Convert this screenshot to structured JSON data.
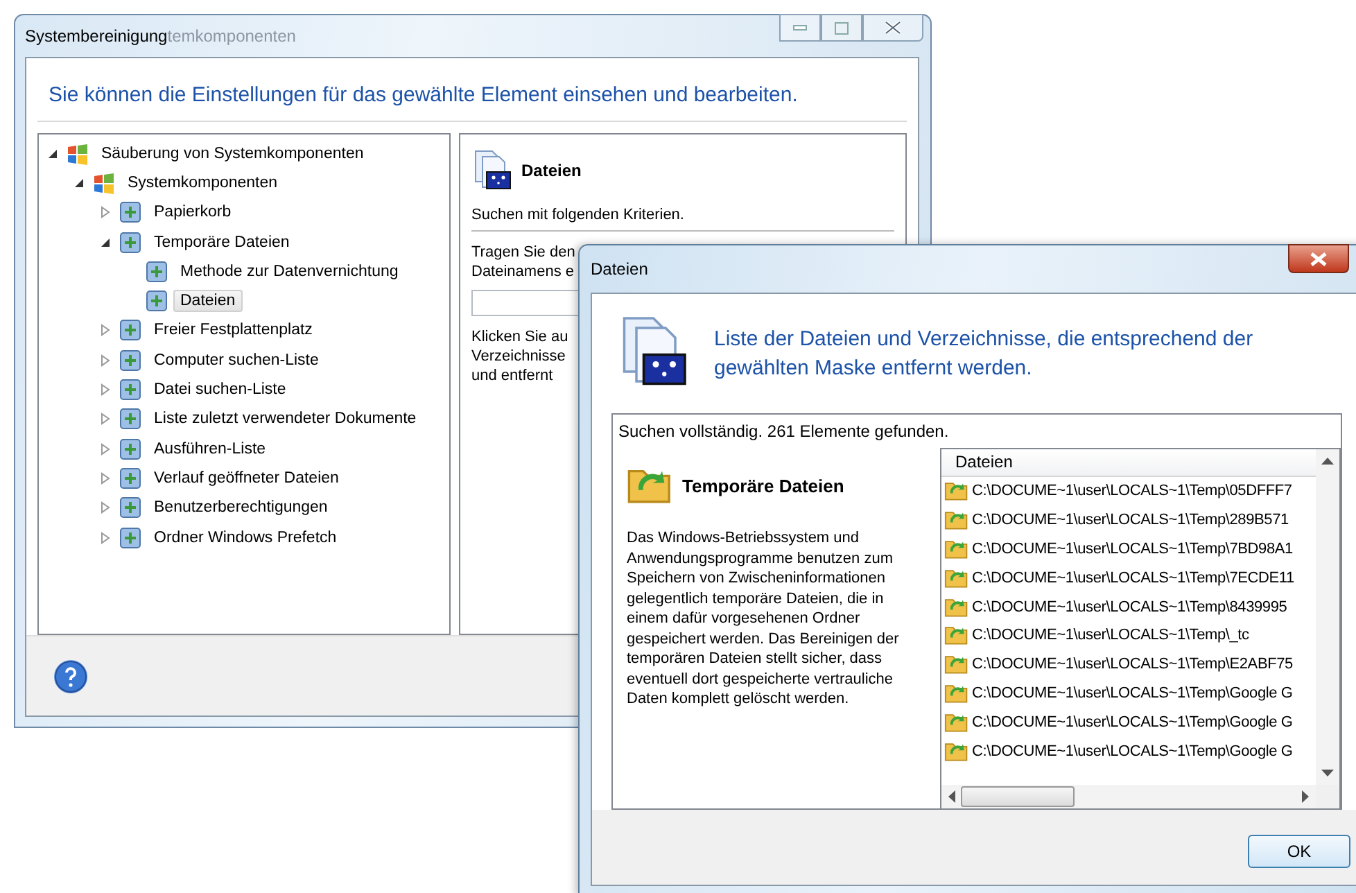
{
  "background_window": {
    "title": "Systembereinigung",
    "title_faded": "temkomponenten",
    "heading": "Sie können die Einstellungen für das gewählte Element einsehen und bearbeiten.",
    "tree": [
      {
        "label": "Säuberung von Systemkomponenten",
        "expanded": true,
        "selected": false,
        "children": [
          {
            "label": "Systemkomponenten",
            "expanded": true,
            "selected": false,
            "children": [
              {
                "label": "Papierkorb",
                "expanded": false,
                "selected": false
              },
              {
                "label": "Temporäre Dateien",
                "expanded": true,
                "selected": false,
                "children": [
                  {
                    "label": "Methode zur Datenvernichtung",
                    "selected": false
                  },
                  {
                    "label": "Dateien",
                    "selected": true
                  }
                ]
              },
              {
                "label": "Freier Festplattenplatz",
                "expanded": false,
                "selected": false
              },
              {
                "label": "Computer suchen-Liste",
                "expanded": false,
                "selected": false
              },
              {
                "label": "Datei suchen-Liste",
                "expanded": false,
                "selected": false
              },
              {
                "label": "Liste zuletzt verwendeter Dokumente",
                "expanded": false,
                "selected": false
              },
              {
                "label": "Ausführen-Liste",
                "expanded": false,
                "selected": false
              },
              {
                "label": "Verlauf geöffneter Dateien",
                "expanded": false,
                "selected": false
              },
              {
                "label": "Benutzerberechtigungen",
                "expanded": false,
                "selected": false
              },
              {
                "label": "Ordner Windows Prefetch",
                "expanded": false,
                "selected": false
              }
            ]
          }
        ]
      }
    ],
    "detail": {
      "title": "Dateien",
      "criteria": "Suchen mit folgenden Kriterien.",
      "hint_lines": [
        "Tragen Sie den",
        "Dateinamens e"
      ],
      "note_lines": [
        "Klicken Sie au",
        "Verzeichnisse",
        "und entfernt"
      ]
    }
  },
  "dialog": {
    "title": "Dateien",
    "heading": "Liste der Dateien und Verzeichnisse, die entsprechend der gewählten Maske entfernt werden.",
    "status": "Suchen vollständig. 261 Elemente gefunden.",
    "category": "Temporäre Dateien",
    "description": "Das Windows-Betriebssystem und Anwendungsprogramme benutzen zum Speichern von Zwischeninformationen gelegentlich temporäre Dateien, die in einem dafür vorgesehenen Ordner gespeichert werden. Das Bereinigen der temporären Dateien stellt sicher, dass eventuell dort gespeicherte vertrauliche Daten komplett gelöscht werden.",
    "list": {
      "column": "Dateien",
      "rows": [
        "C:\\DOCUME~1\\user\\LOCALS~1\\Temp\\05DFFF7",
        "C:\\DOCUME~1\\user\\LOCALS~1\\Temp\\289B571",
        "C:\\DOCUME~1\\user\\LOCALS~1\\Temp\\7BD98A1",
        "C:\\DOCUME~1\\user\\LOCALS~1\\Temp\\7ECDE11",
        "C:\\DOCUME~1\\user\\LOCALS~1\\Temp\\8439995",
        "C:\\DOCUME~1\\user\\LOCALS~1\\Temp\\_tc",
        "C:\\DOCUME~1\\user\\LOCALS~1\\Temp\\E2ABF75",
        "C:\\DOCUME~1\\user\\LOCALS~1\\Temp\\Google G",
        "C:\\DOCUME~1\\user\\LOCALS~1\\Temp\\Google G",
        "C:\\DOCUME~1\\user\\LOCALS~1\\Temp\\Google G"
      ]
    },
    "buttons": [
      "OK"
    ]
  }
}
